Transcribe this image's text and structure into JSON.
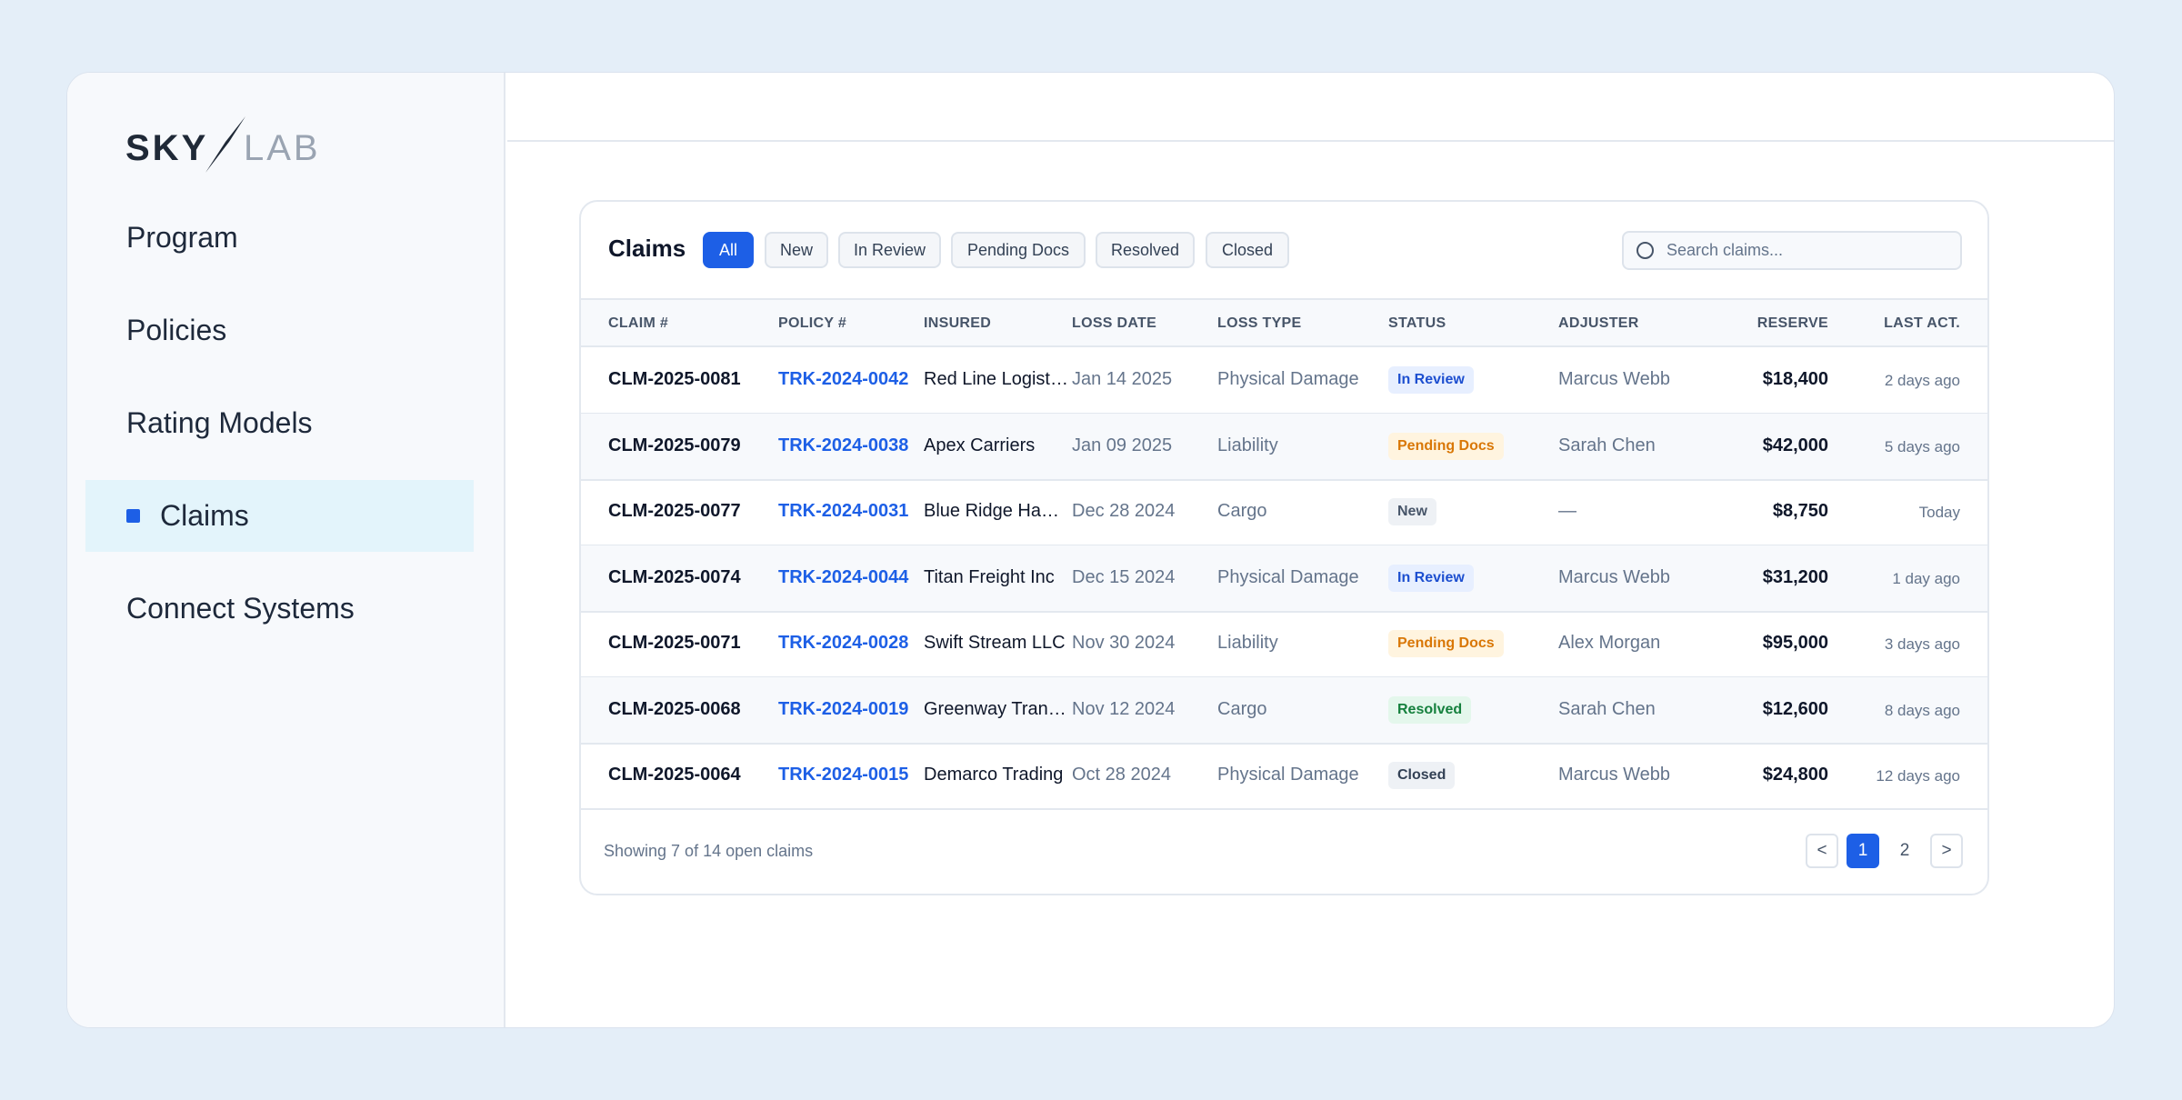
{
  "brand": {
    "name": "SKYLAB",
    "part1": "SKY",
    "part2": "LAB"
  },
  "sidebar": {
    "items": [
      {
        "label": "Program"
      },
      {
        "label": "Policies"
      },
      {
        "label": "Rating Models"
      },
      {
        "label": "Claims",
        "active": true
      },
      {
        "label": "Connect Systems"
      }
    ]
  },
  "claims": {
    "title": "Claims",
    "filters": [
      "All",
      "New",
      "In Review",
      "Pending Docs",
      "Resolved",
      "Closed"
    ],
    "active_filter": "All",
    "search": {
      "placeholder": "Search claims..."
    },
    "columns": [
      "CLAIM #",
      "POLICY #",
      "INSURED",
      "LOSS DATE",
      "LOSS TYPE",
      "STATUS",
      "ADJUSTER",
      "RESERVE",
      "LAST ACT."
    ],
    "rows": [
      {
        "claim": "CLM-2025-0081",
        "policy": "TRK-2024-0042",
        "insured": "Red Line Logistics",
        "loss_date": "Jan 14 2025",
        "loss_type": "Physical Damage",
        "status": "In Review",
        "adjuster": "Marcus Webb",
        "reserve": "$18,400",
        "last_act": "2 days ago"
      },
      {
        "claim": "CLM-2025-0079",
        "policy": "TRK-2024-0038",
        "insured": "Apex Carriers",
        "loss_date": "Jan 09 2025",
        "loss_type": "Liability",
        "status": "Pending Docs",
        "adjuster": "Sarah Chen",
        "reserve": "$42,000",
        "last_act": "5 days ago"
      },
      {
        "claim": "CLM-2025-0077",
        "policy": "TRK-2024-0031",
        "insured": "Blue Ridge Hauling",
        "loss_date": "Dec 28 2024",
        "loss_type": "Cargo",
        "status": "New",
        "adjuster": "—",
        "reserve": "$8,750",
        "last_act": "Today"
      },
      {
        "claim": "CLM-2025-0074",
        "policy": "TRK-2024-0044",
        "insured": "Titan Freight Inc",
        "loss_date": "Dec 15 2024",
        "loss_type": "Physical Damage",
        "status": "In Review",
        "adjuster": "Marcus Webb",
        "reserve": "$31,200",
        "last_act": "1 day ago"
      },
      {
        "claim": "CLM-2025-0071",
        "policy": "TRK-2024-0028",
        "insured": "Swift Stream LLC",
        "loss_date": "Nov 30 2024",
        "loss_type": "Liability",
        "status": "Pending Docs",
        "adjuster": "Alex Morgan",
        "reserve": "$95,000",
        "last_act": "3 days ago"
      },
      {
        "claim": "CLM-2025-0068",
        "policy": "TRK-2024-0019",
        "insured": "Greenway Transport",
        "loss_date": "Nov 12 2024",
        "loss_type": "Cargo",
        "status": "Resolved",
        "adjuster": "Sarah Chen",
        "reserve": "$12,600",
        "last_act": "8 days ago"
      },
      {
        "claim": "CLM-2025-0064",
        "policy": "TRK-2024-0015",
        "insured": "Demarco Trading",
        "loss_date": "Oct 28 2024",
        "loss_type": "Physical Damage",
        "status": "Closed",
        "adjuster": "Marcus Webb",
        "reserve": "$24,800",
        "last_act": "12 days ago"
      }
    ],
    "footer": "Showing 7 of 14 open claims",
    "pagination": {
      "prev": "<",
      "pages": [
        "1",
        "2"
      ],
      "current": "1",
      "next": ">"
    }
  },
  "colors": {
    "accent": "#1d5fe6",
    "background": "#e4eef8"
  }
}
